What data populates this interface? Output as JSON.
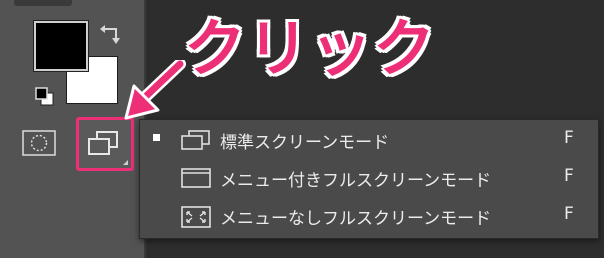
{
  "annotation": {
    "title": "クリック",
    "color": "#ec2f77"
  },
  "tools": {
    "foreground_color": "#000000",
    "background_color": "#ffffff",
    "swap_icon": "swap-colors-icon",
    "default_icon": "default-colors-icon",
    "quickmask_icon": "quick-mask-icon",
    "screenmode_icon": "screen-mode-icon"
  },
  "menu": {
    "items": [
      {
        "label": "標準スクリーンモード",
        "shortcut": "F",
        "checked": true,
        "icon": "standard-screen-mode-icon"
      },
      {
        "label": "メニュー付きフルスクリーンモード",
        "shortcut": "F",
        "checked": false,
        "icon": "full-screen-with-menu-icon"
      },
      {
        "label": "メニューなしフルスクリーンモード",
        "shortcut": "F",
        "checked": false,
        "icon": "full-screen-mode-icon"
      }
    ]
  }
}
